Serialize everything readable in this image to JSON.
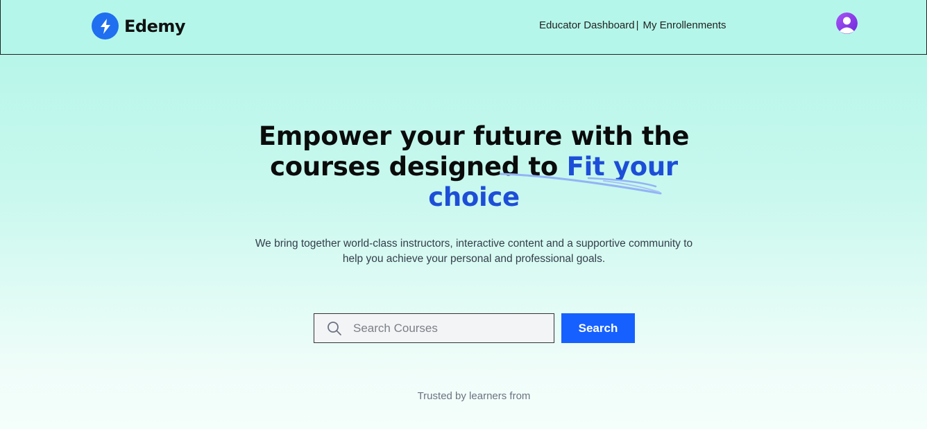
{
  "header": {
    "logo_text": "Edemy",
    "nav": {
      "educator_dashboard": "Educator Dashboard",
      "separator": "|",
      "my_enrollments": "My Enrollenments"
    }
  },
  "hero": {
    "title_part1": "Empower your future with the courses designed to ",
    "title_accent": "Fit your choice",
    "subtitle": "We bring together world-class instructors, interactive content and a supportive community to help you achieve your personal and professional goals."
  },
  "search": {
    "placeholder": "Search Courses",
    "button_label": "Search"
  },
  "trusted_text": "Trusted by learners from",
  "colors": {
    "accent": "#1d4ed8",
    "button": "#1660ff",
    "logo": "#1f6ff0",
    "avatar": "#7c3aed"
  },
  "icons": {
    "logo": "lightning-bolt-icon",
    "search": "search-icon",
    "avatar": "user-avatar-icon"
  }
}
